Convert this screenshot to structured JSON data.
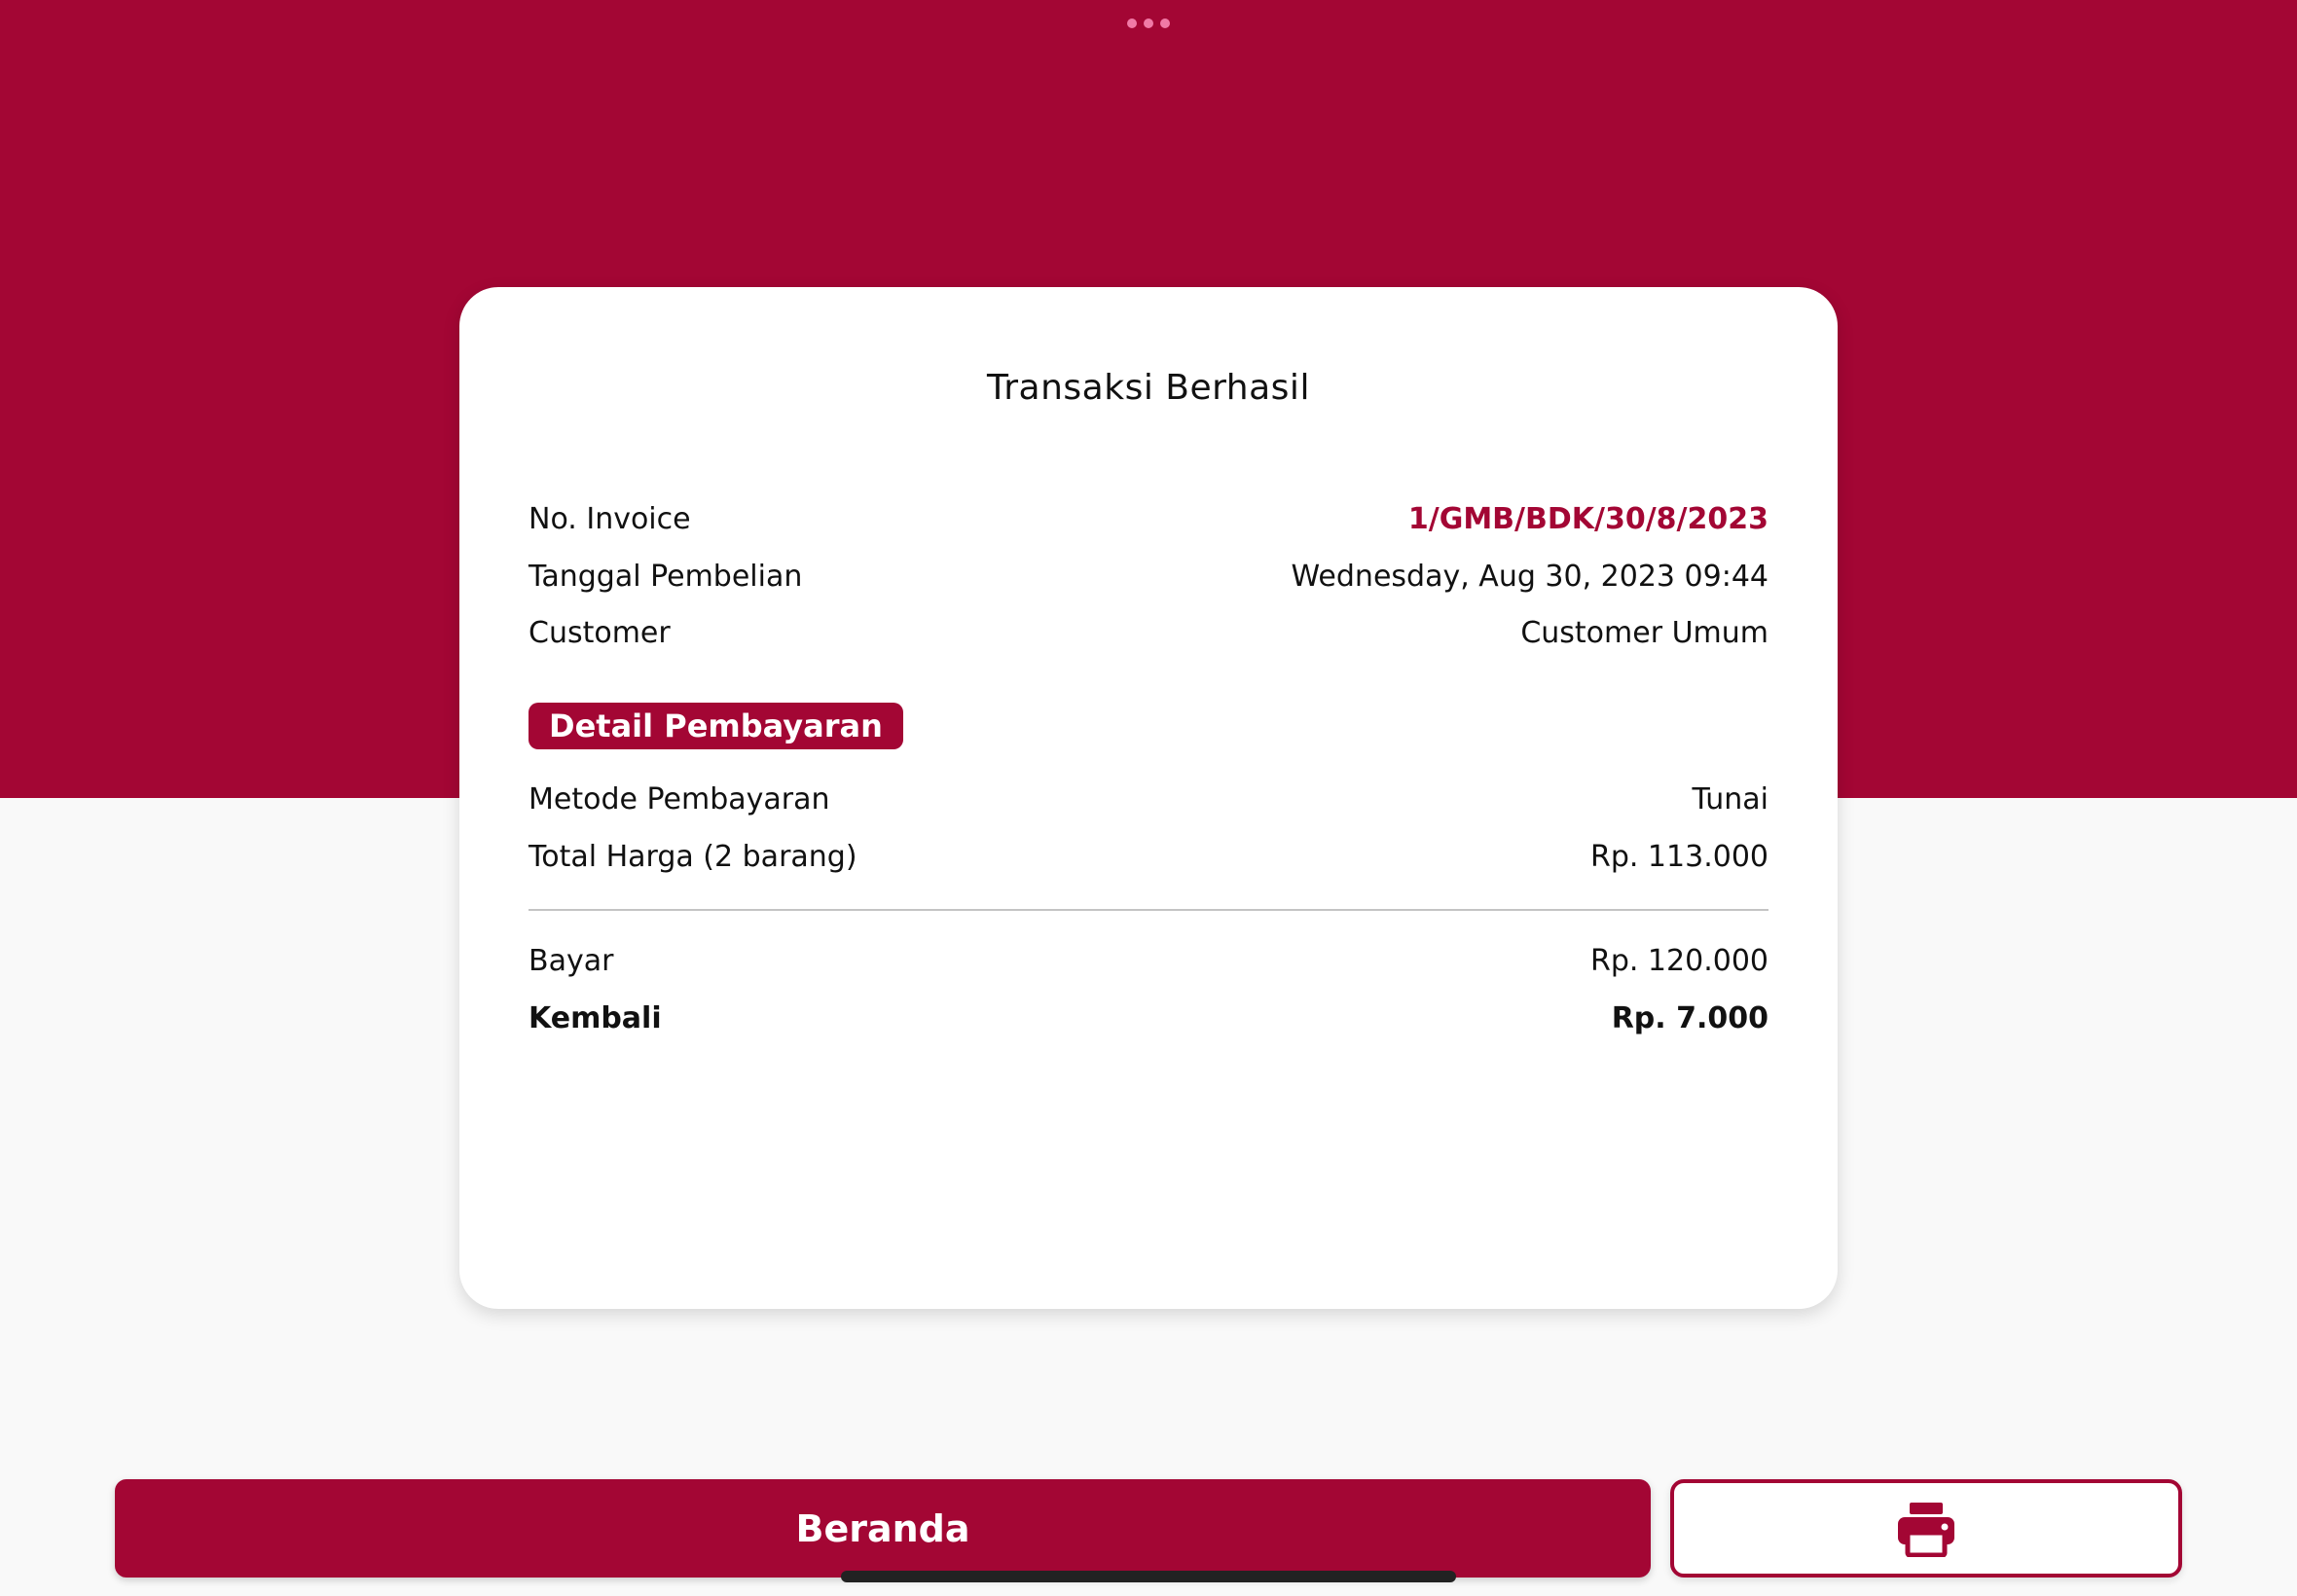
{
  "title": "Transaksi Berhasil",
  "info": {
    "invoice_label": "No. Invoice",
    "invoice_value": "1/GMB/BDK/30/8/2023",
    "date_label": "Tanggal Pembelian",
    "date_value": "Wednesday, Aug 30, 2023 09:44",
    "customer_label": "Customer",
    "customer_value": "Customer Umum"
  },
  "payment": {
    "section_label": "Detail Pembayaran",
    "method_label": "Metode Pembayaran",
    "method_value": "Tunai",
    "total_label": "Total Harga (2 barang)",
    "total_value": "Rp. 113.000",
    "paid_label": "Bayar",
    "paid_value": "Rp. 120.000",
    "change_label": "Kembali",
    "change_value": "Rp. 7.000"
  },
  "actions": {
    "home_label": "Beranda",
    "print_icon": "printer-icon"
  },
  "colors": {
    "primary": "#a30634",
    "background": "#f9f9f9",
    "card": "#ffffff"
  }
}
